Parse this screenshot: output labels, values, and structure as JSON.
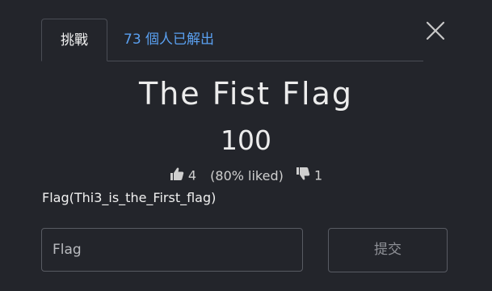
{
  "tabs": {
    "challenge_label": "挑戰",
    "solves_label": "73 個人已解出"
  },
  "challenge": {
    "name": "The Fist Flag",
    "value": "100",
    "description": "Flag(Thi3_is_the_First_flag)"
  },
  "ratings": {
    "likes": "4",
    "liked_percent": "(80% liked)",
    "dislikes": "1"
  },
  "form": {
    "flag_placeholder": "Flag",
    "submit_label": "提交"
  },
  "icons": {
    "close": "close-icon",
    "like": "thumbs-up-icon",
    "dislike": "thumbs-down-icon"
  },
  "colors": {
    "background": "#23252b",
    "accent_link": "#5aa0f0",
    "border": "#585b63"
  }
}
